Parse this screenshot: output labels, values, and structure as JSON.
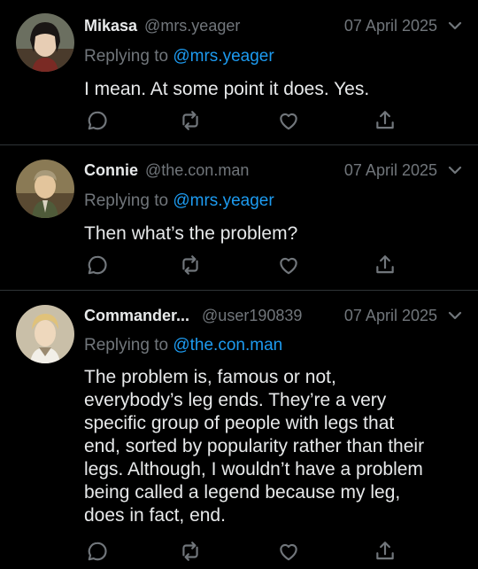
{
  "replies": [
    {
      "name": "Mikasa",
      "handle": "@mrs.yeager",
      "date": "07 April 2025",
      "replying_prefix": "Replying to",
      "replying_to": "@mrs.yeager",
      "text": "I mean. At some point it does. Yes."
    },
    {
      "name": "Connie",
      "handle": "@the.con.man",
      "date": "07 April 2025",
      "replying_prefix": "Replying to",
      "replying_to": "@mrs.yeager",
      "text": "Then what’s the problem?"
    },
    {
      "name": "Commander...",
      "handle": "@user190839",
      "date": "07 April 2025",
      "replying_prefix": "Replying to",
      "replying_to": "@the.con.man",
      "text_lines": [
        "The problem is, famous or not,",
        "everybody’s leg ends. They’re a very",
        "specific group of people with legs that",
        "end, sorted by popularity rather than their",
        "legs. Although, I wouldn’t have a problem",
        "being called a legend because my leg,",
        "does in fact, end."
      ]
    }
  ],
  "icons": {
    "reply": "reply-icon",
    "retweet": "retweet-icon",
    "like": "like-icon",
    "share": "share-icon",
    "menu": "chevron-down-icon"
  },
  "colors": {
    "background": "#000000",
    "text": "#e7e9ea",
    "muted": "#71767b",
    "link": "#1d9bf0",
    "divider": "#2f3336"
  }
}
